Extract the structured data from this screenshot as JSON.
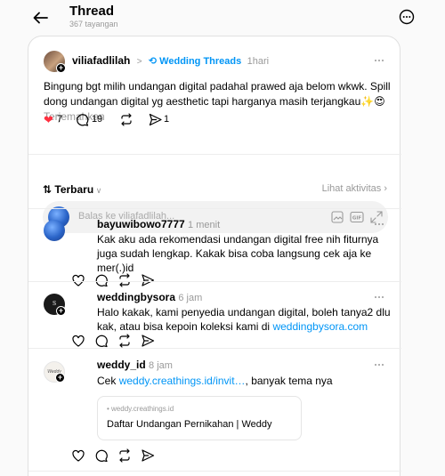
{
  "header": {
    "title": "Thread",
    "views": "367 tayangan"
  },
  "post": {
    "username": "viliafadlilah",
    "separator": ">",
    "community": "Wedding Threads",
    "time": "1hari",
    "text": "Bingung bgt milih undangan digital padahal prawed aja belom wkwk. Spill dong undangan digital yg aesthetic tapi harganya masih terjangkau",
    "emoji": "✨😍",
    "translate": "Terjemahkan",
    "likes": "7",
    "comments": "19",
    "shares": "1"
  },
  "sort": {
    "label": "Terbaru",
    "activity": "Lihat aktivitas"
  },
  "reply": {
    "placeholder": "Balas ke viliafadlilah..."
  },
  "comments": [
    {
      "username": "bayuwibowo7777",
      "time": "1 menit",
      "text": "Kak aku ada rekomendasi undangan digital free nih fiturnya juga sudah lengkap. Kakak bisa coba langsung cek aja ke mer(.)id"
    },
    {
      "username": "weddingbysora",
      "time": "6 jam",
      "text_before": "Halo kakak, kami penyedia undangan digital, boleh tanya2 dlu kak, atau bisa kepoin koleksi kami di ",
      "link": "weddingbysora.com"
    },
    {
      "username": "weddy_id",
      "time": "8 jam",
      "text_before": "Cek ",
      "link": "weddy.creathings.id/invit…",
      "text_after": ", banyak tema nya",
      "preview_domain": "weddy.creathings.id",
      "preview_title": "Daftar Undangan Pernikahan | Weddy",
      "avatar_text": "Weddy"
    }
  ],
  "colors": {
    "like": "#ff3040",
    "link": "#0095f6",
    "muted": "#999999"
  }
}
